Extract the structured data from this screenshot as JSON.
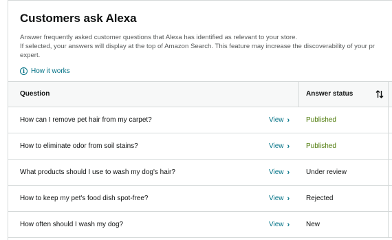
{
  "header": {
    "title": "Customers ask Alexa",
    "desc_line1": "Answer frequently asked customer questions that Alexa has identified as relevant to your store.",
    "desc_line2": "If selected, your answers will display at the top of Amazon Search. This feature may increase the discoverability of your pr",
    "desc_line3": "expert.",
    "how_it_works": "How it works",
    "info_icon": "i"
  },
  "table": {
    "col_question": "Question",
    "col_status": "Answer status",
    "view_label": "View",
    "chevron": "›",
    "rows": [
      {
        "question": "How can I remove pet hair from my carpet?",
        "status": "Published",
        "status_color": "#4d7a08"
      },
      {
        "question": "How to eliminate odor from soil stains?",
        "status": "Published",
        "status_color": "#4d7a08"
      },
      {
        "question": "What products should I use to wash my dog's hair?",
        "status": "Under review",
        "status_color": "#0f1111"
      },
      {
        "question": "How to keep my pet's food dish spot-free?",
        "status": "Rejected",
        "status_color": "#0f1111"
      },
      {
        "question": "How often should I wash my dog?",
        "status": "New",
        "status_color": "#0f1111"
      }
    ]
  },
  "colors": {
    "link": "#007185",
    "published": "#4d7a08",
    "text": "#0f1111",
    "muted": "#565959"
  }
}
